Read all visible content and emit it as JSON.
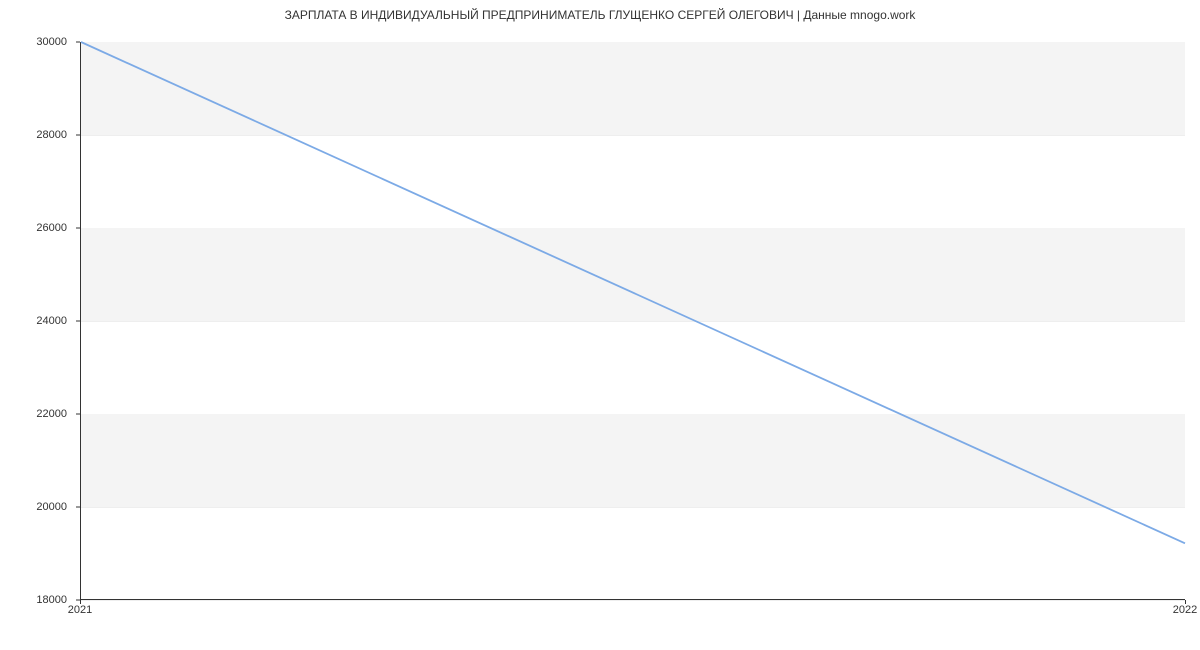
{
  "chart_data": {
    "type": "line",
    "title": "ЗАРПЛАТА В ИНДИВИДУАЛЬНЫЙ ПРЕДПРИНИМАТЕЛЬ ГЛУЩЕНКО СЕРГЕЙ ОЛЕГОВИЧ | Данные mnogo.work",
    "xlabel": "",
    "ylabel": "",
    "x": [
      2021,
      2022
    ],
    "values": [
      30000,
      19200
    ],
    "x_ticks": [
      2021,
      2022
    ],
    "y_ticks": [
      18000,
      20000,
      22000,
      24000,
      26000,
      28000,
      30000
    ],
    "ylim": [
      18000,
      30000
    ],
    "xlim": [
      2021,
      2022
    ],
    "line_color": "#7caae6",
    "band_color": "#f4f4f4"
  }
}
